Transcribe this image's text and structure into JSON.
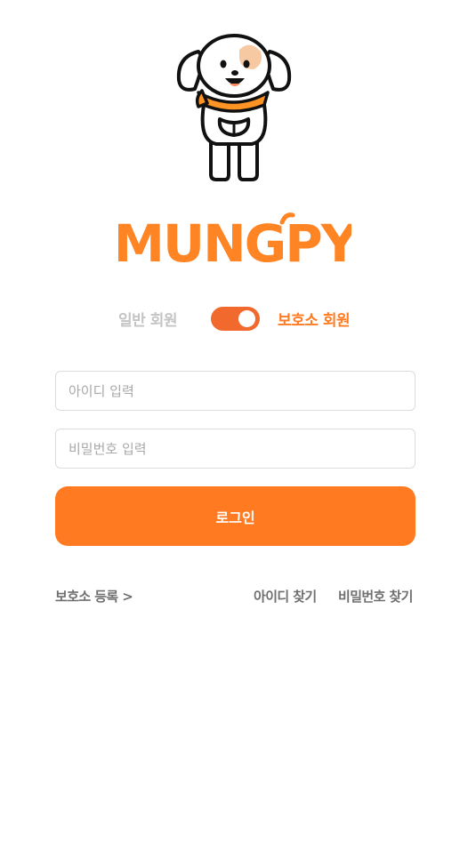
{
  "brand": {
    "logo_text": "MUNGPY",
    "accent": "#ff7a21",
    "toggle_color": "#f2692d"
  },
  "member_toggle": {
    "general_label": "일반 회원",
    "shelter_label": "보호소 회원",
    "selected": "보호소 회원"
  },
  "form": {
    "id_placeholder": "아이디 입력",
    "password_placeholder": "비밀번호 입력",
    "login_label": "로그인"
  },
  "links": {
    "register_label": "보호소 등록 >",
    "find_id_label": "아이디 찾기",
    "find_password_label": "비밀번호 찾기"
  },
  "icons": {
    "mascot": "dog-mascot-icon"
  }
}
